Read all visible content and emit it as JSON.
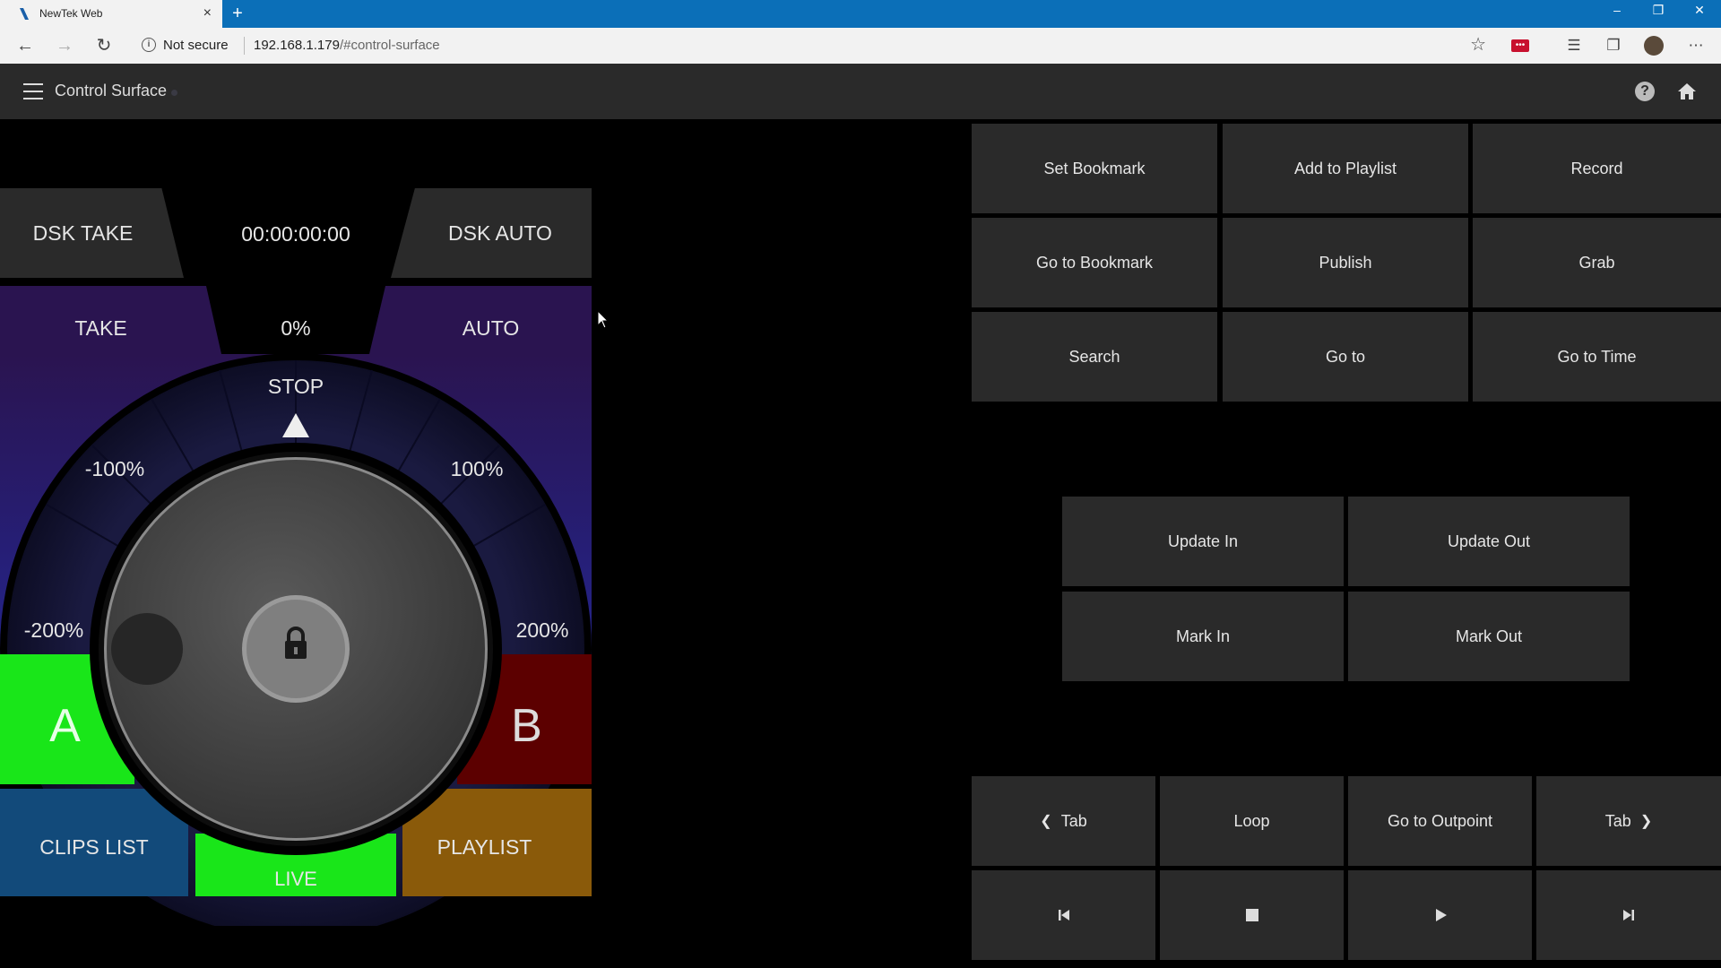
{
  "browser": {
    "tab_title": "NewTek Web",
    "tab_close": "×",
    "new_tab": "+",
    "security_label": "Not secure",
    "url_host": "192.168.1.179",
    "url_path": "/#control-surface",
    "window_controls": {
      "minimize": "–",
      "restore": "❐",
      "close": "✕"
    },
    "nav": {
      "back": "←",
      "forward": "→",
      "reload": "↻"
    },
    "toolbar_icons": [
      "favorites-icon",
      "collections-icon",
      "profile-avatar",
      "more-icon"
    ]
  },
  "app": {
    "title": "Control Surface",
    "icons": [
      "menu-icon",
      "help-icon",
      "home-icon"
    ]
  },
  "transition": {
    "dsk_take": "DSK TAKE",
    "timecode": "00:00:00:00",
    "dsk_auto": "DSK AUTO",
    "take": "TAKE",
    "percent": "0%",
    "auto": "AUTO",
    "stop": "STOP",
    "neg100": "-100%",
    "pos100": "100%",
    "neg200": "-200%",
    "pos200": "200%",
    "a_label": "A",
    "b_label": "B",
    "clips_list": "CLIPS LIST",
    "live": "LIVE",
    "playlist": "PLAYLIST"
  },
  "actions": {
    "top_grid": [
      "Set Bookmark",
      "Add to Playlist",
      "Record",
      "Go to Bookmark",
      "Publish",
      "Grab",
      "Search",
      "Go to",
      "Go to Time"
    ],
    "mid_grid": [
      "Update In",
      "Update Out",
      "Mark In",
      "Mark Out"
    ],
    "bottom_row": [
      "Tab",
      "Loop",
      "Go to Outpoint",
      "Tab"
    ],
    "transport_icons": [
      "skip-back-icon",
      "stop-icon",
      "play-icon",
      "skip-forward-icon"
    ]
  },
  "colors": {
    "a_green": "#19e619",
    "b_red": "#5c0000",
    "clips_blue": "#124a7a",
    "playlist_orange": "#8a5a0a",
    "live_green": "#19e619",
    "purple_top": "#2a1450",
    "purple_bottom": "#24248a"
  }
}
